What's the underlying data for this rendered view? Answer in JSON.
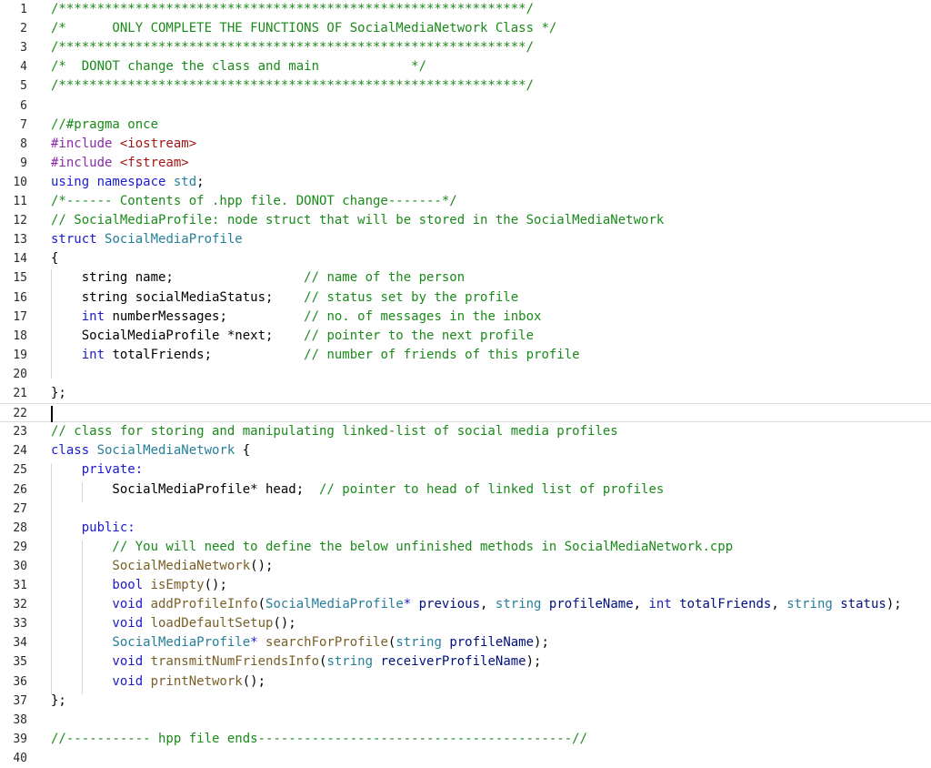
{
  "line_numbers": [
    "1",
    "2",
    "3",
    "4",
    "5",
    "6",
    "7",
    "8",
    "9",
    "10",
    "11",
    "12",
    "13",
    "14",
    "15",
    "16",
    "17",
    "18",
    "19",
    "20",
    "21",
    "22",
    "23",
    "24",
    "25",
    "26",
    "27",
    "28",
    "29",
    "30",
    "31",
    "32",
    "33",
    "34",
    "35",
    "36",
    "37",
    "38",
    "39",
    "40"
  ],
  "current_line": "22",
  "lines": [
    [
      {
        "c": "comment",
        "t": "/*************************************************************/"
      }
    ],
    [
      {
        "c": "comment",
        "t": "/*      ONLY COMPLETE THE FUNCTIONS OF SocialMediaNetwork Class */"
      }
    ],
    [
      {
        "c": "comment",
        "t": "/*************************************************************/"
      }
    ],
    [
      {
        "c": "comment",
        "t": "/*  DONOT change the class and main            */"
      }
    ],
    [
      {
        "c": "comment",
        "t": "/*************************************************************/"
      }
    ],
    [],
    [
      {
        "c": "comment",
        "t": "//#pragma once"
      }
    ],
    [
      {
        "c": "pre",
        "t": "#include "
      },
      {
        "c": "str",
        "t": "<iostream>"
      }
    ],
    [
      {
        "c": "pre",
        "t": "#include "
      },
      {
        "c": "str",
        "t": "<fstream>"
      }
    ],
    [
      {
        "c": "kw",
        "t": "using namespace "
      },
      {
        "c": "type",
        "t": "std"
      },
      {
        "c": "plain",
        "t": ";"
      }
    ],
    [
      {
        "c": "comment",
        "t": "/*------ Contents of .hpp file. DONOT change-------*/"
      }
    ],
    [
      {
        "c": "comment",
        "t": "// SocialMediaProfile: node struct that will be stored in the SocialMediaNetwork"
      }
    ],
    [
      {
        "c": "kw",
        "t": "struct "
      },
      {
        "c": "type",
        "t": "SocialMediaProfile"
      }
    ],
    [
      {
        "c": "plain",
        "t": "{"
      }
    ],
    [
      {
        "c": "plain",
        "t": "    string name;                 "
      },
      {
        "c": "comment",
        "t": "// name of the person"
      }
    ],
    [
      {
        "c": "plain",
        "t": "    string socialMediaStatus;    "
      },
      {
        "c": "comment",
        "t": "// status set by the profile"
      }
    ],
    [
      {
        "c": "kw",
        "t": "    int "
      },
      {
        "c": "plain",
        "t": "numberMessages;          "
      },
      {
        "c": "comment",
        "t": "// no. of messages in the inbox"
      }
    ],
    [
      {
        "c": "plain",
        "t": "    SocialMediaProfile *next;    "
      },
      {
        "c": "comment",
        "t": "// pointer to the next profile"
      }
    ],
    [
      {
        "c": "kw",
        "t": "    int "
      },
      {
        "c": "plain",
        "t": "totalFriends;            "
      },
      {
        "c": "comment",
        "t": "// number of friends of this profile"
      }
    ],
    [],
    [
      {
        "c": "plain",
        "t": "};"
      }
    ],
    [],
    [
      {
        "c": "comment",
        "t": "// class for storing and manipulating linked-list of social media profiles"
      }
    ],
    [
      {
        "c": "kw",
        "t": "class "
      },
      {
        "c": "type",
        "t": "SocialMediaNetwork"
      },
      {
        "c": "plain",
        "t": " {"
      }
    ],
    [
      {
        "c": "kw",
        "t": "    private:"
      }
    ],
    [
      {
        "c": "plain",
        "t": "        SocialMediaProfile* head;  "
      },
      {
        "c": "comment",
        "t": "// pointer to head of linked list of profiles"
      }
    ],
    [],
    [
      {
        "c": "kw",
        "t": "    public:"
      }
    ],
    [
      {
        "c": "comment",
        "t": "        // You will need to define the below unfinished methods in SocialMediaNetwork.cpp"
      }
    ],
    [
      {
        "c": "fn",
        "t": "        SocialMediaNetwork"
      },
      {
        "c": "plain",
        "t": "();"
      }
    ],
    [
      {
        "c": "kw",
        "t": "        bool "
      },
      {
        "c": "fn",
        "t": "isEmpty"
      },
      {
        "c": "plain",
        "t": "();"
      }
    ],
    [
      {
        "c": "kw",
        "t": "        void "
      },
      {
        "c": "fn",
        "t": "addProfileInfo"
      },
      {
        "c": "plain",
        "t": "("
      },
      {
        "c": "type",
        "t": "SocialMediaProfile"
      },
      {
        "c": "kw",
        "t": "* "
      },
      {
        "c": "param",
        "t": "previous"
      },
      {
        "c": "plain",
        "t": ", "
      },
      {
        "c": "type",
        "t": "string "
      },
      {
        "c": "param",
        "t": "profileName"
      },
      {
        "c": "plain",
        "t": ", "
      },
      {
        "c": "kw",
        "t": "int "
      },
      {
        "c": "param",
        "t": "totalFriends"
      },
      {
        "c": "plain",
        "t": ", "
      },
      {
        "c": "type",
        "t": "string "
      },
      {
        "c": "param",
        "t": "status"
      },
      {
        "c": "plain",
        "t": ");"
      }
    ],
    [
      {
        "c": "kw",
        "t": "        void "
      },
      {
        "c": "fn",
        "t": "loadDefaultSetup"
      },
      {
        "c": "plain",
        "t": "();"
      }
    ],
    [
      {
        "c": "type",
        "t": "        SocialMediaProfile"
      },
      {
        "c": "kw",
        "t": "* "
      },
      {
        "c": "fn",
        "t": "searchForProfile"
      },
      {
        "c": "plain",
        "t": "("
      },
      {
        "c": "type",
        "t": "string "
      },
      {
        "c": "param",
        "t": "profileName"
      },
      {
        "c": "plain",
        "t": ");"
      }
    ],
    [
      {
        "c": "kw",
        "t": "        void "
      },
      {
        "c": "fn",
        "t": "transmitNumFriendsInfo"
      },
      {
        "c": "plain",
        "t": "("
      },
      {
        "c": "type",
        "t": "string "
      },
      {
        "c": "param",
        "t": "receiverProfileName"
      },
      {
        "c": "plain",
        "t": ");"
      }
    ],
    [
      {
        "c": "kw",
        "t": "        void "
      },
      {
        "c": "fn",
        "t": "printNetwork"
      },
      {
        "c": "plain",
        "t": "();"
      }
    ],
    [
      {
        "c": "plain",
        "t": "};"
      }
    ],
    [],
    [
      {
        "c": "comment",
        "t": "//----------- hpp file ends-----------------------------------------//"
      }
    ],
    []
  ]
}
